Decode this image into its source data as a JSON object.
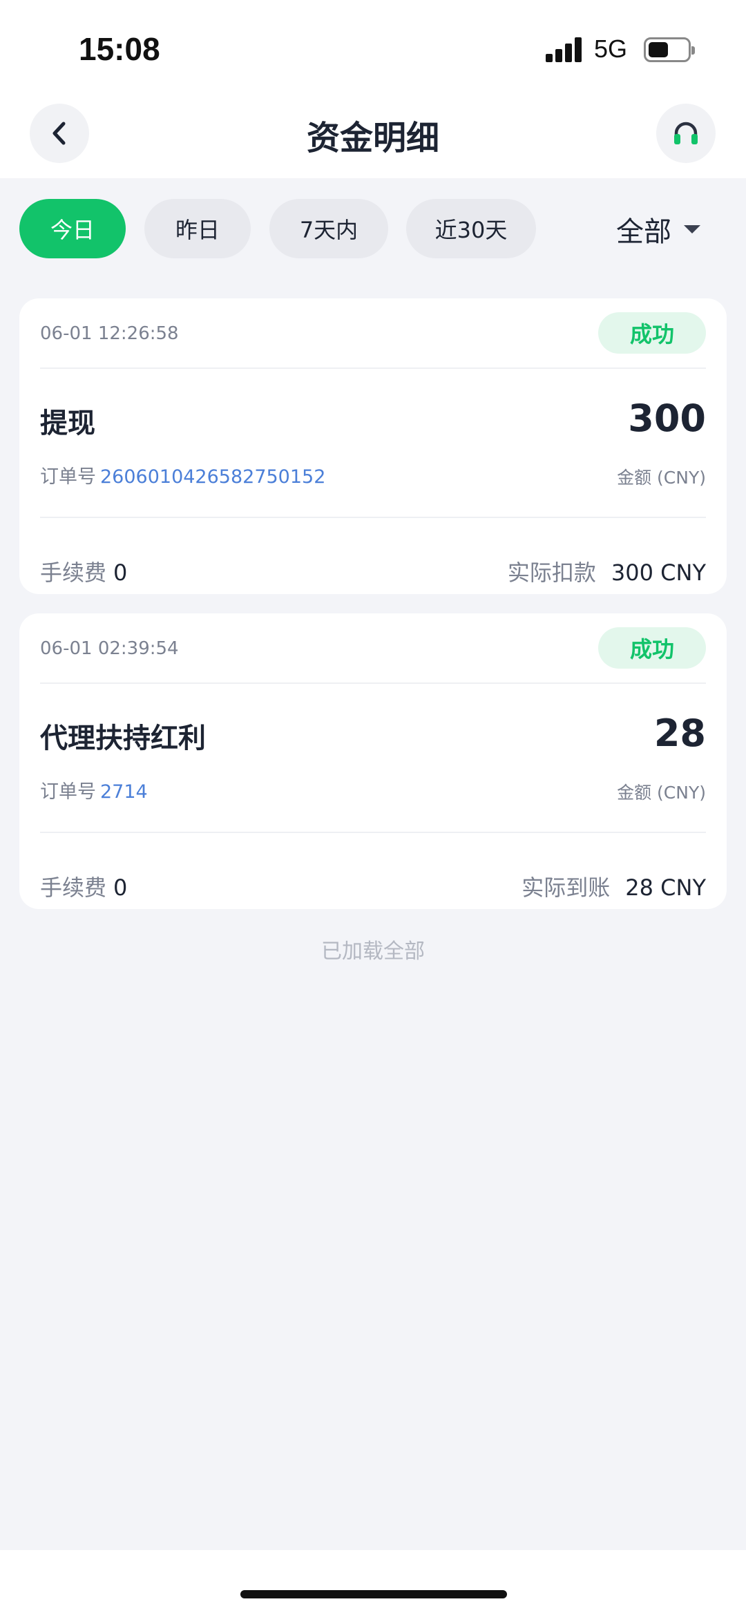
{
  "status_bar": {
    "time": "15:08",
    "network": "5G"
  },
  "nav": {
    "title": "资金明细"
  },
  "filters": {
    "chips": [
      {
        "label": "今日",
        "active": true
      },
      {
        "label": "昨日",
        "active": false
      },
      {
        "label": "7天内",
        "active": false
      },
      {
        "label": "近30天",
        "active": false
      }
    ],
    "type_selector": "全部"
  },
  "records": [
    {
      "time": "06-01 12:26:58",
      "status": "成功",
      "type": "提现",
      "amount": "300",
      "order_label": "订单号",
      "order_no": "2606010426582750152",
      "amount_label": "金额 (CNY)",
      "fee_label": "手续费",
      "fee": "0",
      "actual_label": "实际扣款",
      "actual": "300 CNY"
    },
    {
      "time": "06-01 02:39:54",
      "status": "成功",
      "type": "代理扶持红利",
      "amount": "28",
      "order_label": "订单号",
      "order_no": "2714",
      "amount_label": "金额 (CNY)",
      "fee_label": "手续费",
      "fee": "0",
      "actual_label": "实际到账",
      "actual": "28 CNY"
    }
  ],
  "footer": {
    "loaded_text": "已加载全部"
  },
  "colors": {
    "accent": "#12c36a",
    "link": "#4b7fd8",
    "badge_bg": "#e3f7ec"
  }
}
